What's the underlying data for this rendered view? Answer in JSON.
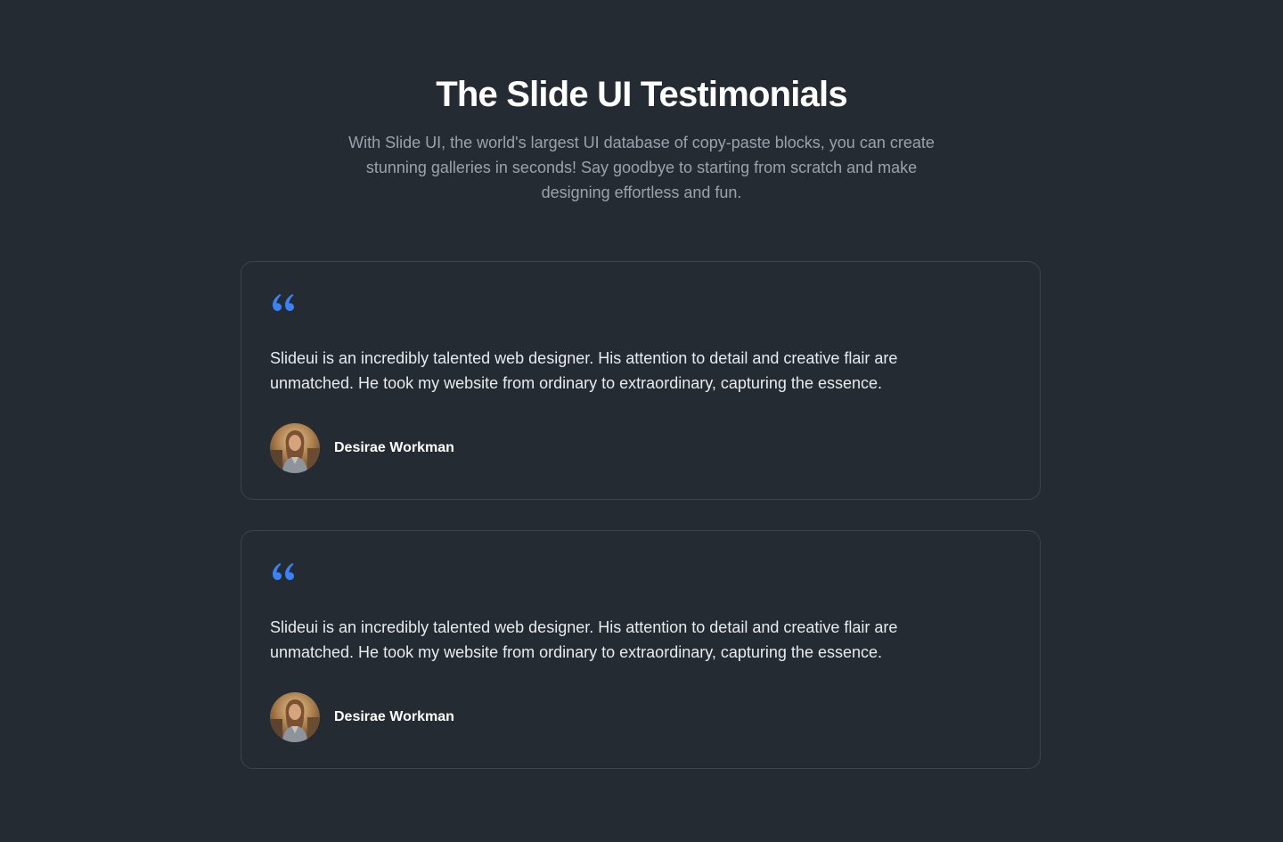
{
  "header": {
    "title": "The Slide UI Testimonials",
    "subtitle": "With Slide UI, the world's largest UI database of copy-paste blocks, you can create stunning galleries in seconds! Say goodbye to starting from scratch and make designing effortless and fun."
  },
  "testimonials": [
    {
      "quote_icon": "quote-icon",
      "text": "Slideui is an incredibly talented web designer. His attention to detail and creative flair are unmatched. He took my website from ordinary to extraordinary, capturing the essence.",
      "author": "Desirae Workman"
    },
    {
      "quote_icon": "quote-icon",
      "text": "Slideui is an incredibly talented web designer. His attention to detail and creative flair are unmatched. He took my website from ordinary to extraordinary, capturing the essence.",
      "author": "Desirae Workman"
    }
  ],
  "colors": {
    "background": "#252b32",
    "accent": "#3b82f6",
    "border": "#3d444d",
    "muted_text": "#9aa2ad"
  }
}
